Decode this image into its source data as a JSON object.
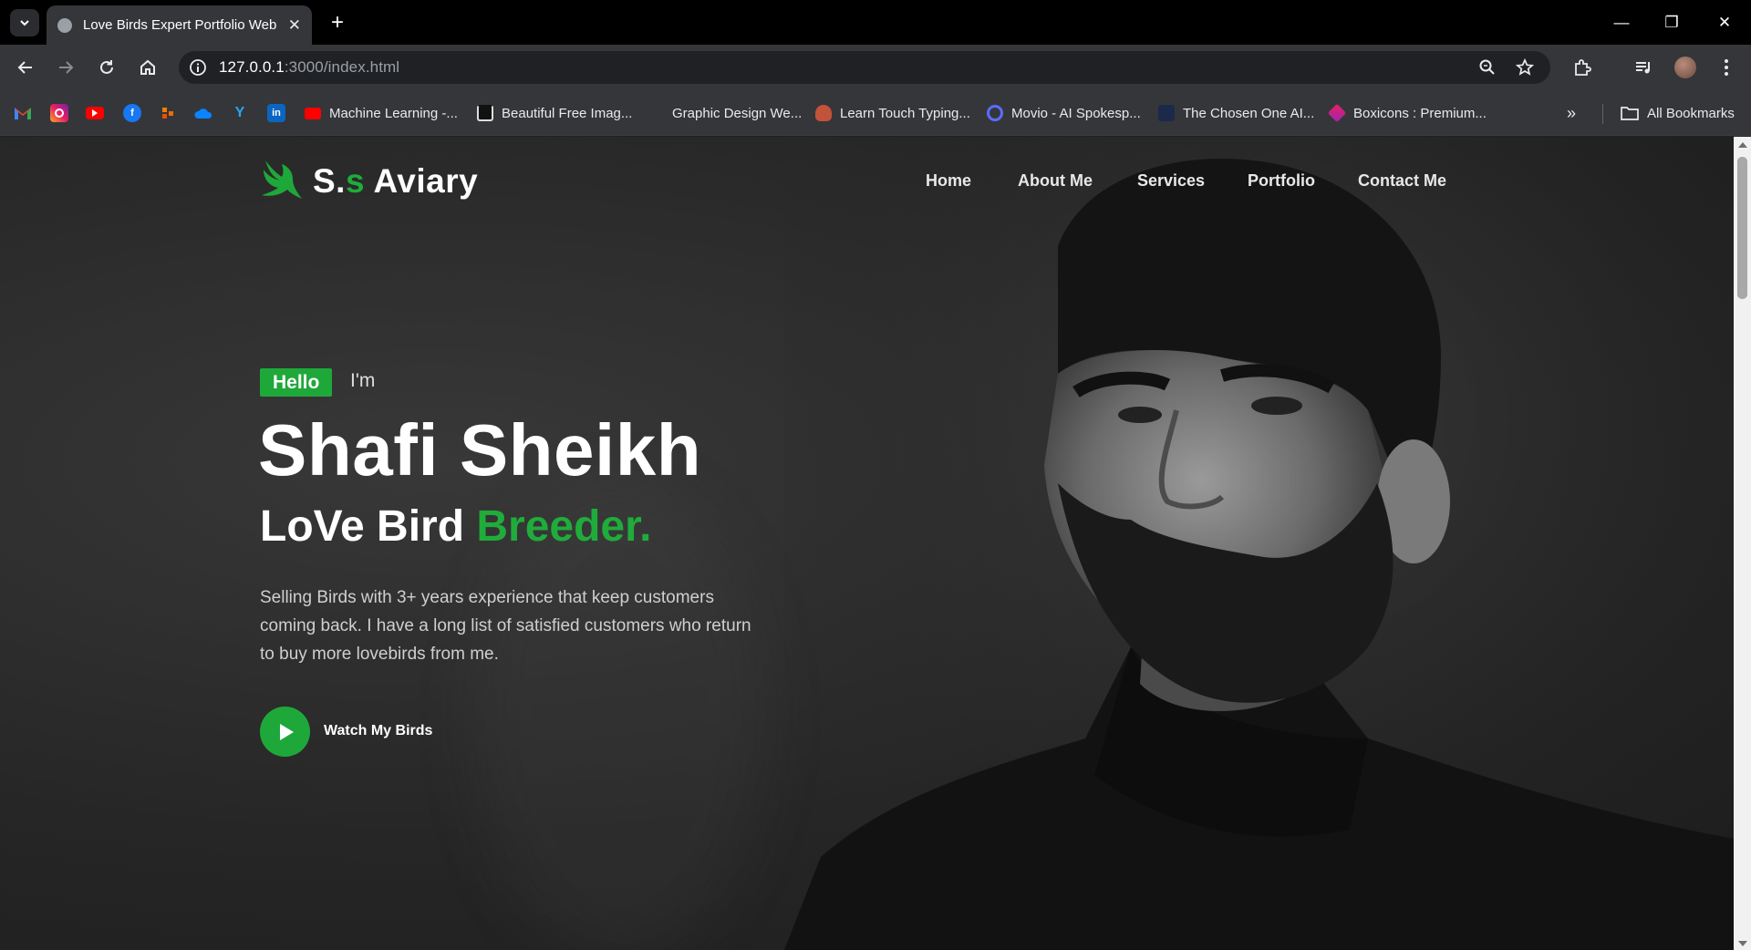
{
  "browser": {
    "tab_title": "Love Birds Expert Portfolio Web",
    "url_host": "127.0.0.1",
    "url_path": ":3000/index.html",
    "bookmarks": [
      {
        "label": "Machine Learning -..."
      },
      {
        "label": "Beautiful Free Imag..."
      },
      {
        "label": "Graphic Design We..."
      },
      {
        "label": "Learn Touch Typing..."
      },
      {
        "label": "Movio - AI Spokesp..."
      },
      {
        "label": "The Chosen One AI..."
      },
      {
        "label": "Boxicons : Premium..."
      }
    ],
    "all_bookmarks": "All Bookmarks"
  },
  "site": {
    "logo_prefix": "S.",
    "logo_accent": "s",
    "logo_suffix": " Aviary",
    "nav": [
      "Home",
      "About Me",
      "Services",
      "Portfolio",
      "Contact Me"
    ],
    "hero": {
      "hello": "Hello",
      "im": "I'm",
      "name": "Shafi Sheikh",
      "role_white": "LoVe Bird ",
      "role_green": "Breeder.",
      "description": "Selling Birds with 3+ years experience that keep customers coming back. I have a long list of satisfied customers who return to buy more lovebirds from me.",
      "cta": "Watch My Birds"
    }
  },
  "colors": {
    "accent": "#1fac3b",
    "background": "#262626"
  }
}
